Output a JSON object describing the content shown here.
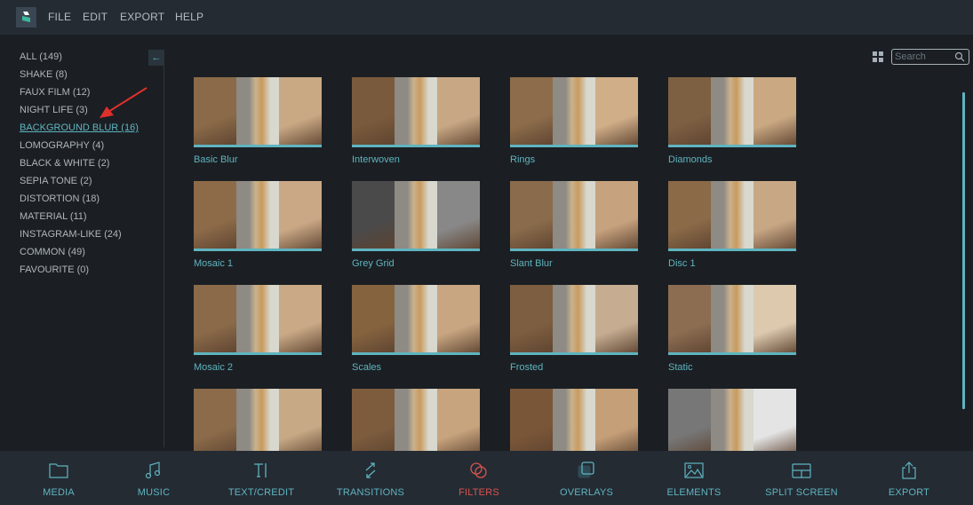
{
  "menubar": {
    "items": [
      "FILE",
      "EDIT",
      "EXPORT",
      "HELP"
    ]
  },
  "sidebar": {
    "categories": [
      {
        "label": "ALL (149)",
        "active": false
      },
      {
        "label": "SHAKE (8)",
        "active": false
      },
      {
        "label": "FAUX FILM (12)",
        "active": false
      },
      {
        "label": "NIGHT LIFE (3)",
        "active": false
      },
      {
        "label": "BACKGROUND BLUR (16)",
        "active": true
      },
      {
        "label": "LOMOGRAPHY (4)",
        "active": false
      },
      {
        "label": "BLACK & WHITE (2)",
        "active": false
      },
      {
        "label": "SEPIA TONE (2)",
        "active": false
      },
      {
        "label": "DISTORTION (18)",
        "active": false
      },
      {
        "label": "MATERIAL (11)",
        "active": false
      },
      {
        "label": "INSTAGRAM-LIKE (24)",
        "active": false
      },
      {
        "label": "COMMON (49)",
        "active": false
      },
      {
        "label": "FAVOURITE (0)",
        "active": false
      }
    ],
    "collapse_icon": "arrow-left-icon"
  },
  "search": {
    "placeholder": "Search",
    "value": ""
  },
  "filters": [
    {
      "name": "Basic Blur"
    },
    {
      "name": "Interwoven"
    },
    {
      "name": "Rings"
    },
    {
      "name": "Diamonds"
    },
    {
      "name": "Mosaic 1"
    },
    {
      "name": "Grey Grid"
    },
    {
      "name": "Slant Blur"
    },
    {
      "name": "Disc 1"
    },
    {
      "name": "Mosaic 2"
    },
    {
      "name": "Scales"
    },
    {
      "name": "Frosted"
    },
    {
      "name": "Static"
    },
    {
      "name": ""
    },
    {
      "name": ""
    },
    {
      "name": ""
    },
    {
      "name": ""
    }
  ],
  "bottom_tabs": [
    {
      "label": "MEDIA",
      "icon": "folder-icon",
      "active": false
    },
    {
      "label": "MUSIC",
      "icon": "music-note-icon",
      "active": false
    },
    {
      "label": "TEXT/CREDIT",
      "icon": "text-cursor-icon",
      "active": false
    },
    {
      "label": "TRANSITIONS",
      "icon": "transitions-arrows-icon",
      "active": false
    },
    {
      "label": "FILTERS",
      "icon": "filters-circles-icon",
      "active": true
    },
    {
      "label": "OVERLAYS",
      "icon": "overlay-squares-icon",
      "active": false
    },
    {
      "label": "ELEMENTS",
      "icon": "image-icon",
      "active": false
    },
    {
      "label": "SPLIT SCREEN",
      "icon": "split-screen-icon",
      "active": false
    },
    {
      "label": "EXPORT",
      "icon": "share-export-icon",
      "active": false
    }
  ],
  "colors": {
    "accent": "#5fb4c0",
    "active_tab": "#d9534f",
    "background": "#1b1f23",
    "bar_background": "#242b33"
  }
}
